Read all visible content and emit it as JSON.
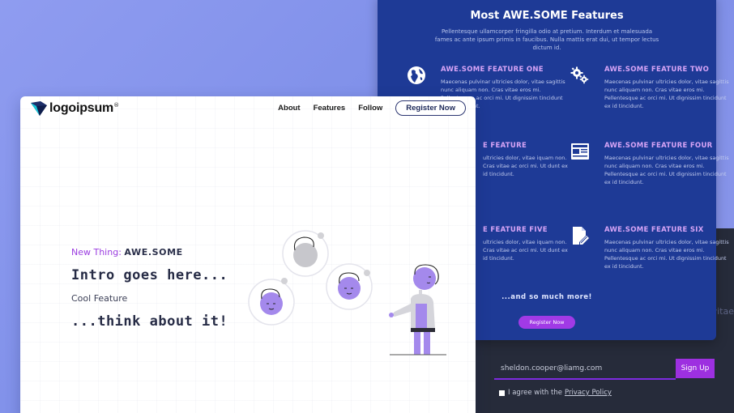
{
  "features": {
    "title": "Most AWE.SOME Features",
    "subtitle": "Pellentesque ullamcorper fringilla odio at pretium. Interdum et malesuada fames ac ante ipsum primis in faucibus. Nulla mattis erat dui, ut tempor lectus dictum id.",
    "items": [
      {
        "icon": "globe-icon",
        "title": "AWE.SOME FEATURE ONE",
        "text": "Maecenas pulvinar ultricies dolor, vitae sagittis nunc aliquam non. Cras vitae eros mi. Pellentesque ac orci mi. Ut dignissim tincidunt ex id tincidunt."
      },
      {
        "icon": "gears-icon",
        "title": "AWE.SOME FEATURE TWO",
        "text": "Maecenas pulvinar ultricies dolor, vitae sagittis nunc aliquam non. Cras vitae eros mi. Pellentesque ac orci mi. Ut dignissim tincidunt ex id tincidunt."
      },
      {
        "icon": "hidden-icon",
        "title": "E FEATURE",
        "text": "ultricies dolor, vitae iquam non. Cras vitae ac orci mi. Ut dunt ex id tincidunt."
      },
      {
        "icon": "newspaper-icon",
        "title": "AWE.SOME FEATURE FOUR",
        "text": "Maecenas pulvinar ultricies dolor, vitae sagittis nunc aliquam non. Cras vitae eros mi. Pellentesque ac orci mi. Ut dignissim tincidunt ex id tincidunt."
      },
      {
        "icon": "hidden-icon",
        "title": "E FEATURE FIVE",
        "text": "ultricies dolor, vitae iquam non. Cras vitae ac orci mi. Ut dunt ex id tincidunt."
      },
      {
        "icon": "file-edit-icon",
        "title": "AWE.SOME FEATURE SIX",
        "text": "Maecenas pulvinar ultricies dolor, vitae sagittis nunc aliquam non. Cras vitae eros mi. Pellentesque ac orci mi. Ut dignissim tincidunt ex id tincidunt."
      }
    ],
    "more": "...and so much more!",
    "register_label": "Register Now"
  },
  "signup": {
    "edge_text": "vitae",
    "email_value": "sheldon.cooper@liamg.com",
    "button_label": "Sign Up",
    "agree_text": "I agree with the",
    "policy_link": "Privacy Policy"
  },
  "landing": {
    "logo_text": "logoipsum",
    "logo_mark": "®",
    "nav": [
      "About",
      "Features",
      "Follow"
    ],
    "register_label": "Register Now",
    "tagline_prefix": "New Thing: ",
    "tagline_brand": "AWE.SOME",
    "intro": "Intro goes here...",
    "cool": "Cool Feature",
    "think": "...think about it!"
  },
  "colors": {
    "background": "#8a96ec",
    "features_panel": "#1e3a96",
    "accent_purple": "#9d30e0",
    "dark_panel": "#262b3a"
  }
}
